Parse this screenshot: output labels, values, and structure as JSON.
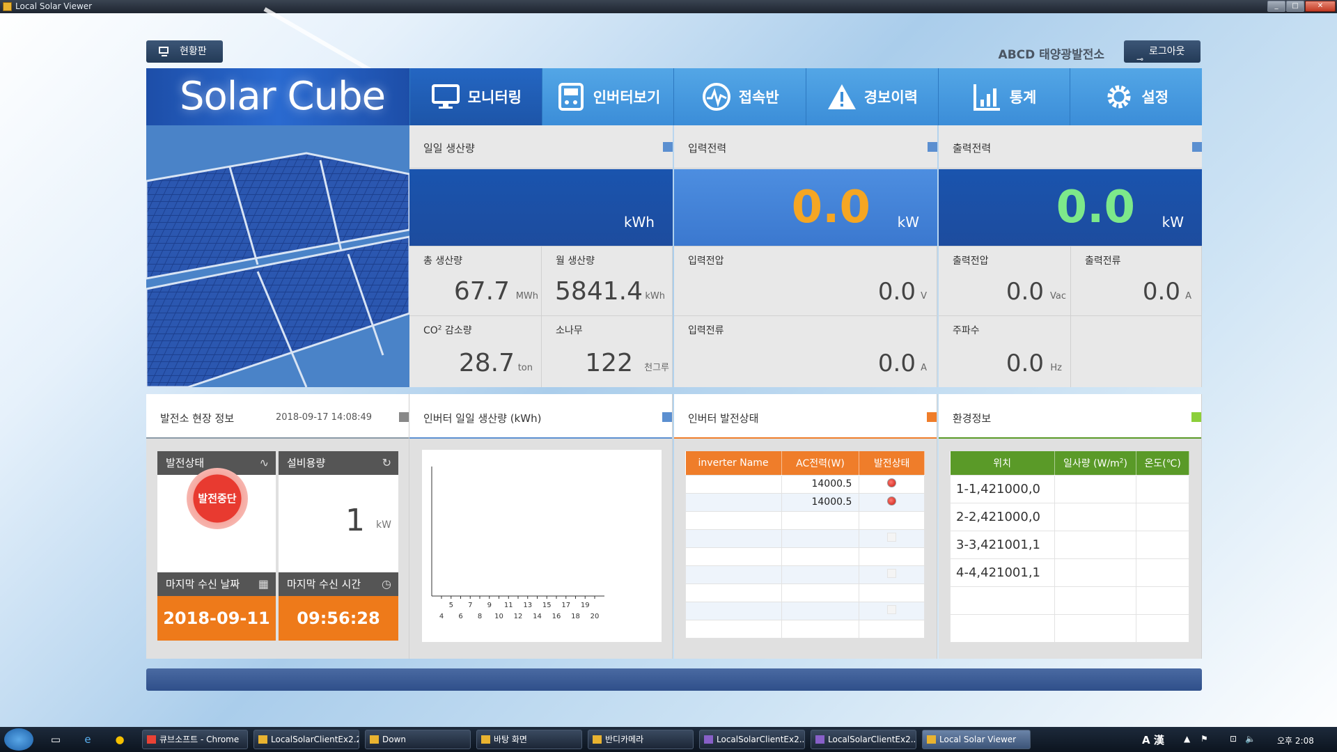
{
  "window": {
    "title": "Local Solar Viewer"
  },
  "top": {
    "dashboard_label": "현황판",
    "site_name": "ABCD 태양광발전소",
    "logout_label": "로그아웃"
  },
  "logo": "Solar Cube",
  "nav": [
    {
      "label": "모니터링",
      "icon": "monitor-icon"
    },
    {
      "label": "인버터보기",
      "icon": "inverter-icon"
    },
    {
      "label": "접속반",
      "icon": "pulse-icon"
    },
    {
      "label": "경보이력",
      "icon": "warning-icon"
    },
    {
      "label": "통계",
      "icon": "stats-icon"
    },
    {
      "label": "설정",
      "icon": "gear-icon"
    }
  ],
  "daily": {
    "label": "일일 생산량",
    "value": "",
    "unit": "kWh",
    "total_label": "총 생산량",
    "total_value": "67.7",
    "total_unit": "MWh",
    "monthly_label": "월 생산량",
    "monthly_value": "5841.4",
    "monthly_unit": "kWh",
    "co2_label_prefix": "CO",
    "co2_label_sup": "2",
    "co2_label_suffix": " 감소량",
    "co2_value": "28.7",
    "co2_unit": "ton",
    "tree_label": "소나무",
    "tree_value": "122",
    "tree_unit": "천그루"
  },
  "input": {
    "label": "입력전력",
    "value": "0.0",
    "unit": "kW",
    "value_color": "#f5a623",
    "voltage_label": "입력전압",
    "voltage_value": "0.0",
    "voltage_unit": "V",
    "current_label": "입력전류",
    "current_value": "0.0",
    "current_unit": "A"
  },
  "output": {
    "label": "출력전력",
    "value": "0.0",
    "unit": "kW",
    "value_color": "#7de88a",
    "voltage_label": "출력전압",
    "voltage_value": "0.0",
    "voltage_unit": "Vac",
    "current_label": "출력전류",
    "current_value": "0.0",
    "current_unit": "A",
    "freq_label": "주파수",
    "freq_value": "0.0",
    "freq_unit": "Hz"
  },
  "site_info": {
    "label": "발전소 현장 정보",
    "timestamp": "2018-09-17 14:08:49",
    "status_label": "발전상태",
    "status_value": "발전중단",
    "capacity_label": "설비용량",
    "capacity_value": "1",
    "capacity_unit": "kW",
    "last_date_label": "마지막 수신 날짜",
    "last_date_value": "2018-09-11",
    "last_time_label": "마지막 수신 시간",
    "last_time_value": "09:56:28"
  },
  "inverter_daily": {
    "label": "인버터 일일 생산량 (kWh)"
  },
  "chart_data": {
    "type": "line",
    "title": "",
    "x_ticks_top": [
      "5",
      "7",
      "9",
      "11",
      "13",
      "15",
      "17",
      "19"
    ],
    "x_ticks_bottom": [
      "4",
      "6",
      "8",
      "10",
      "12",
      "14",
      "16",
      "18",
      "20"
    ],
    "series": []
  },
  "inverter_status": {
    "label": "인버터 발전상태",
    "headers": [
      "inverter Name",
      "AC전력(W)",
      "발전상태"
    ],
    "rows": [
      {
        "name": "",
        "power": "14000.5",
        "status": "red"
      },
      {
        "name": "",
        "power": "14000.5",
        "status": "red"
      },
      {
        "name": "",
        "power": "",
        "status": ""
      },
      {
        "name": "",
        "power": "",
        "status": "empty"
      },
      {
        "name": "",
        "power": "",
        "status": ""
      },
      {
        "name": "",
        "power": "",
        "status": "empty"
      },
      {
        "name": "",
        "power": "",
        "status": ""
      },
      {
        "name": "",
        "power": "",
        "status": "empty"
      },
      {
        "name": "",
        "power": "",
        "status": ""
      }
    ]
  },
  "env": {
    "label": "환경정보",
    "headers": [
      "위치",
      "일사량 (W/m",
      "2",
      ")",
      "온도(℃)"
    ],
    "rows": [
      {
        "loc": "1-1,421000,0",
        "irr": "",
        "temp": ""
      },
      {
        "loc": "2-2,421000,0",
        "irr": "",
        "temp": ""
      },
      {
        "loc": "3-3,421001,1",
        "irr": "",
        "temp": ""
      },
      {
        "loc": "4-4,421001,1",
        "irr": "",
        "temp": ""
      },
      {
        "loc": "",
        "irr": "",
        "temp": ""
      },
      {
        "loc": "",
        "irr": "",
        "temp": ""
      }
    ]
  },
  "taskbar": {
    "items": [
      "큐브소프트 - Chrome",
      "LocalSolarClientEx2.2",
      "Down",
      "바탕 화면",
      "반디카메라",
      "LocalSolarClientEx2....",
      "LocalSolarClientEx2....",
      "Local Solar Viewer"
    ],
    "ime": "A 漢",
    "clock": "오후 2:08"
  },
  "colors": {
    "accent_blue": "#1d55a8",
    "nav_blue": "#3b8dd8",
    "orange": "#ee7a1a",
    "inverter_header": "#ef7d2a",
    "env_header": "#5a9a28",
    "alert_red": "#e83a30"
  }
}
